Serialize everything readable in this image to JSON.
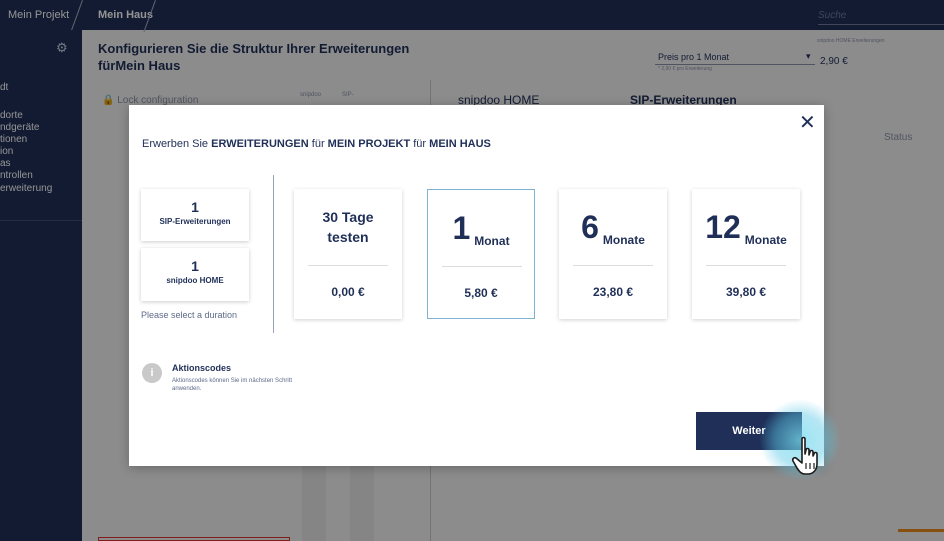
{
  "topbar": {
    "breadcrumb_project": "Mein Projekt",
    "breadcrumb_house": "Mein Haus",
    "search_placeholder": "Suche"
  },
  "sidebar": {
    "items": [
      "dt",
      "dorte",
      "ndgeräte",
      "tionen",
      "ion",
      "as",
      "ntrollen",
      "erweiterung"
    ]
  },
  "background": {
    "title": "Konfigurieren Sie die Struktur Ihrer Erweiterungen fürMein Haus",
    "lock_label": "Lock configuration",
    "col_snipdoo": "snipdoo",
    "col_sip": "SIP-",
    "tab_snipdoo": "snipdoo HOME",
    "tab_sip": "SIP-Erweiterungen",
    "price_select": "Preis pro 1 Monat",
    "price_sub": "* 2,90 € pro Erweiterung",
    "ext_label": "snipdoo HOME Erweiterungen",
    "ext_price": "2,90 €",
    "status_label": "Status"
  },
  "modal": {
    "title_prefix": "Erwerben Sie",
    "title_ext": "ERWEITERUNGEN",
    "title_fuer1": "für",
    "title_project": "MEIN PROJEKT",
    "title_fuer2": "für",
    "title_house": "MEIN HAUS",
    "summary": [
      {
        "count": "1",
        "label": "SIP-Erweiterungen"
      },
      {
        "count": "1",
        "label": "snipdoo HOME"
      }
    ],
    "hint": "Please select a duration",
    "plans": [
      {
        "line1": "30 Tage",
        "line2": "testen",
        "price": "0,00 €"
      },
      {
        "number": "1",
        "unit": "Monat",
        "price": "5,80 €"
      },
      {
        "number": "6",
        "unit": "Monate",
        "price": "23,80 €"
      },
      {
        "number": "12",
        "unit": "Monate",
        "price": "39,80 €"
      }
    ],
    "info_title": "Aktionscodes",
    "info_text": "Aktionscodes können Sie im nächsten Schritt anwenden.",
    "info_icon_glyph": "i",
    "next_button": "Weiter",
    "close_glyph": "✕"
  },
  "colors": {
    "navy": "#1f2f57",
    "selected_border": "#7fb3cf",
    "accent_orange": "#e98a1e"
  }
}
